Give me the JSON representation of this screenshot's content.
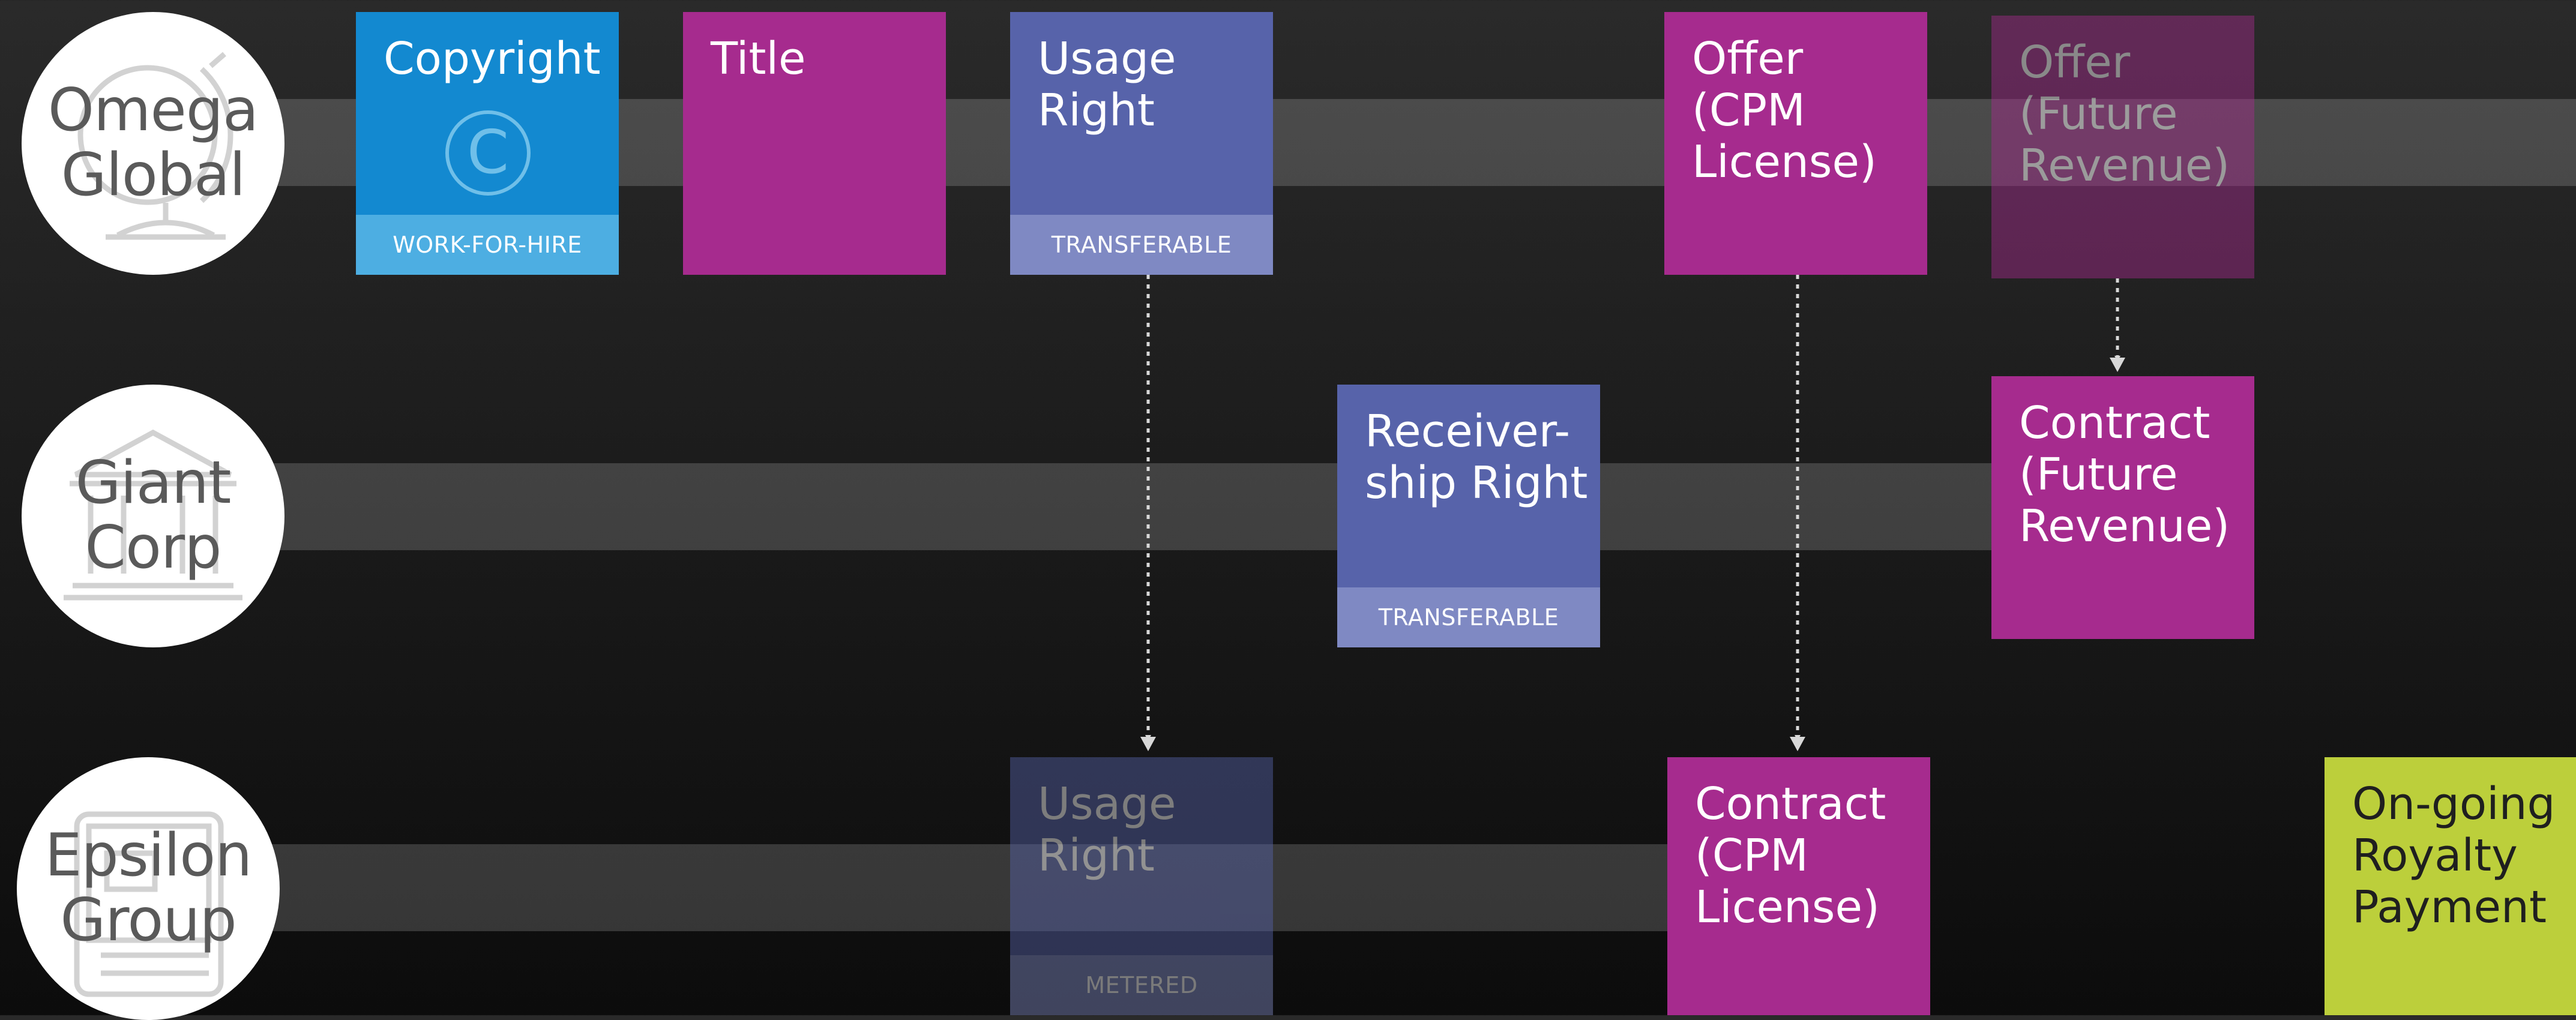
{
  "colors": {
    "magenta": "#a62b8e",
    "indigo": "#5763aa",
    "indigo_footer": "#7f89c3",
    "blue": "#1389d0",
    "blue_footer": "#4daee2",
    "lime": "#bccf3b",
    "lane": "rgba(255,255,255,0.17)",
    "arrow": "#d8d8d8"
  },
  "entities": [
    {
      "name": "Omega\nGlobal",
      "icon": "globe-icon"
    },
    {
      "name": "Giant\nCorp",
      "icon": "bank-building-icon"
    },
    {
      "name": "Epsilon\nGroup",
      "icon": "document-stack-icon"
    }
  ],
  "cards": {
    "copyright": {
      "title": "Copyright",
      "footer": "WORK-FOR-HIRE",
      "icon": "copyright-icon"
    },
    "title": {
      "title": "Title"
    },
    "usage_right_omega": {
      "title": "Usage\nRight",
      "footer": "TRANSFERABLE"
    },
    "offer_cpm": {
      "title": "Offer\n(CPM\nLicense)"
    },
    "offer_future": {
      "title": "Offer\n(Future\nRevenue)"
    },
    "receivership": {
      "title": "Receiver-\nship Right",
      "footer": "TRANSFERABLE"
    },
    "contract_future": {
      "title": "Contract\n(Future\nRevenue)"
    },
    "usage_right_epsilon": {
      "title": "Usage\nRight",
      "footer": "METERED"
    },
    "contract_cpm": {
      "title": "Contract\n(CPM\nLicense)"
    },
    "royalty": {
      "title": "On-going\nRoyalty\nPayment"
    }
  }
}
